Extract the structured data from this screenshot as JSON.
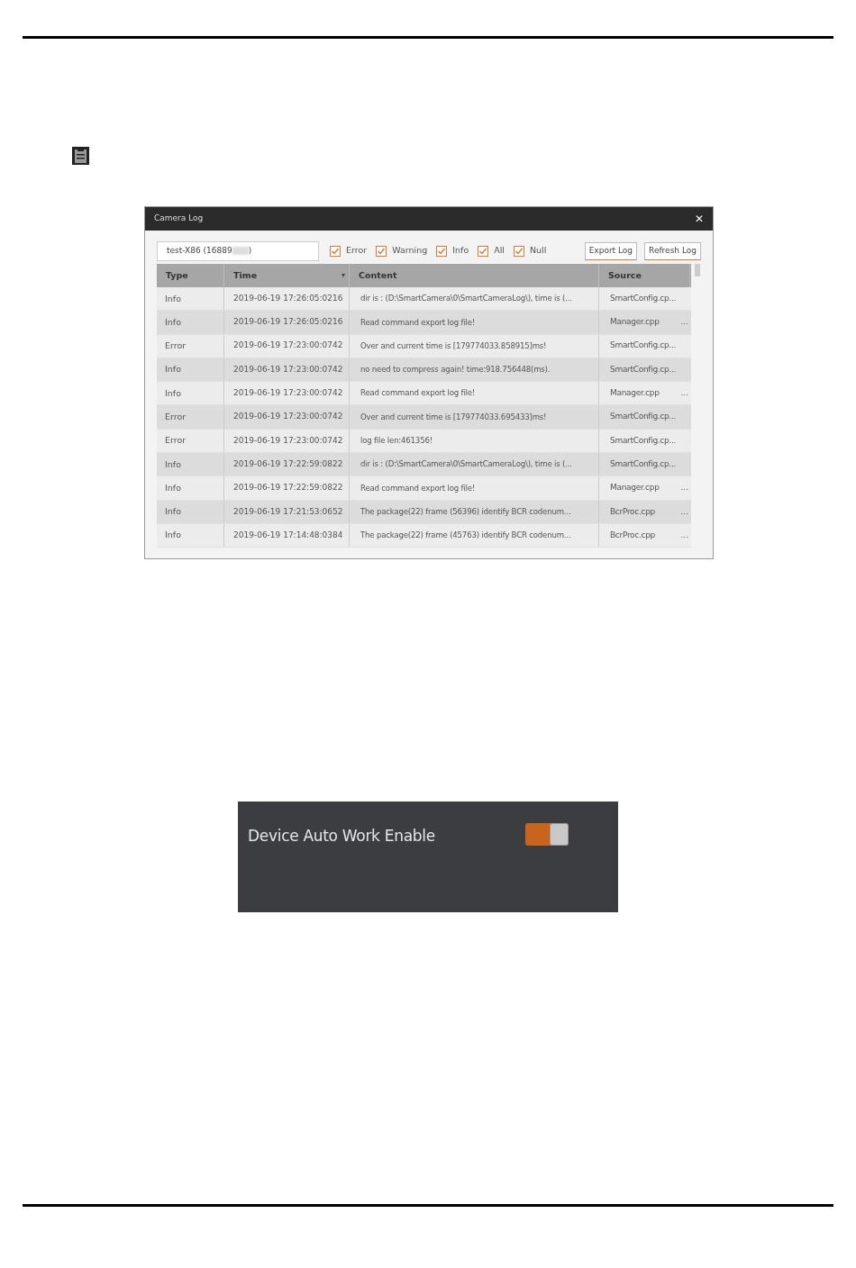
{
  "camera_log": {
    "title": "Camera Log",
    "close": "✕",
    "device": {
      "value": "test-X86 (16889",
      "value_end": ")"
    },
    "filters": [
      {
        "label": "Error",
        "checked": true
      },
      {
        "label": "Warning",
        "checked": true
      },
      {
        "label": "Info",
        "checked": true
      },
      {
        "label": "All",
        "checked": true
      },
      {
        "label": "Null",
        "checked": true
      }
    ],
    "buttons": [
      "Export Log",
      "Refresh Log"
    ],
    "table": {
      "columns": [
        "Type",
        "Time",
        "Content",
        "Source"
      ],
      "sort_mark": "▾",
      "rows": [
        {
          "type": "Info",
          "time": "2019-06-19 17:26:05:0216",
          "content": "dir is : (D:\\SmartCamera\\0\\SmartCameraLog\\), time is (...",
          "source": "SmartConfig.cp..."
        },
        {
          "type": "Info",
          "time": "2019-06-19 17:26:05:0216",
          "content": "Read command export log file!",
          "source": "Manager.cpp",
          "source_more": "..."
        },
        {
          "type": "Error",
          "time": "2019-06-19 17:23:00:0742",
          "content": "Over and current time is  [179774033.858915]ms!",
          "source": "SmartConfig.cp..."
        },
        {
          "type": "Info",
          "time": "2019-06-19 17:23:00:0742",
          "content": "no need to compress again! time:918.756448(ms).",
          "source": "SmartConfig.cp..."
        },
        {
          "type": "Info",
          "time": "2019-06-19 17:23:00:0742",
          "content": "Read command export log file!",
          "source": "Manager.cpp",
          "source_more": "..."
        },
        {
          "type": "Error",
          "time": "2019-06-19 17:23:00:0742",
          "content": "Over and current time is  [179774033.695433]ms!",
          "source": "SmartConfig.cp..."
        },
        {
          "type": "Error",
          "time": "2019-06-19 17:23:00:0742",
          "content": "log file len:461356!",
          "source": "SmartConfig.cp..."
        },
        {
          "type": "Info",
          "time": "2019-06-19 17:22:59:0822",
          "content": "dir is : (D:\\SmartCamera\\0\\SmartCameraLog\\), time is (...",
          "source": "SmartConfig.cp..."
        },
        {
          "type": "Info",
          "time": "2019-06-19 17:22:59:0822",
          "content": "Read command export log file!",
          "source": "Manager.cpp",
          "source_more": "..."
        },
        {
          "type": "Info",
          "time": "2019-06-19 17:21:53:0652",
          "content": "The package(22) frame (56396) identify BCR codenum...",
          "source": "BcrProc.cpp",
          "source_more": "..."
        },
        {
          "type": "Info",
          "time": "2019-06-19 17:14:48:0384",
          "content": "The package(22) frame (45763) identify BCR codenum...",
          "source": "BcrProc.cpp",
          "source_more": "..."
        }
      ]
    }
  },
  "auto_work": {
    "label": "Device Auto Work Enable",
    "on": true
  }
}
